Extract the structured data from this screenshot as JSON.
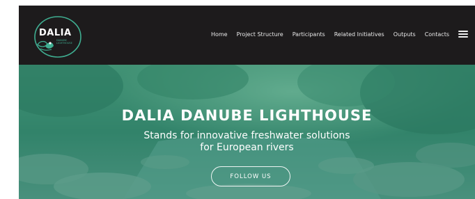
{
  "header": {
    "logo": {
      "title": "DALIA",
      "subtitle": "DANUBE LIGHTHOUSE",
      "icon": "leaf-water-drop-icon"
    },
    "nav": [
      {
        "label": "Home"
      },
      {
        "label": "Project Structure"
      },
      {
        "label": "Participants"
      },
      {
        "label": "Related Initiatives"
      },
      {
        "label": "Outputs"
      },
      {
        "label": "Contacts"
      }
    ],
    "menu_icon": "hamburger-menu-icon"
  },
  "hero": {
    "title": "DALIA DANUBE LIGHTHOUSE",
    "subtitle_line1": "Stands for innovative freshwater solutions",
    "subtitle_line2": "for European rivers",
    "button_label": "FOLLOW US"
  },
  "colors": {
    "header_bg": "#1d1b1c",
    "accent": "#3fae91",
    "hero_overlay": "#29967a",
    "text": "#ffffff"
  }
}
